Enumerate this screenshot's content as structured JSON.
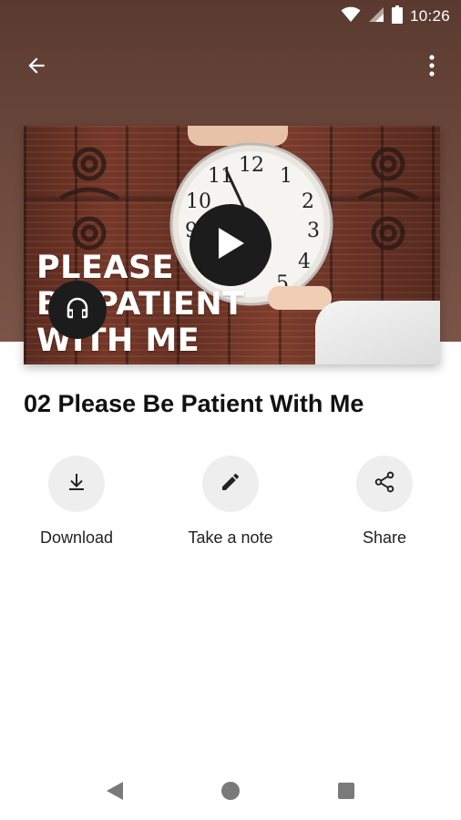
{
  "status_bar": {
    "time": "10:26",
    "icons": [
      "wifi-icon",
      "cell-signal-icon",
      "battery-icon"
    ]
  },
  "app_bar": {
    "back_icon": "arrow-left-icon",
    "menu_icon": "more-vertical-icon"
  },
  "thumbnail": {
    "title_text": "PLEASE\nBE PATIENT\nWITH ME",
    "clock_numbers": [
      "12",
      "1",
      "2",
      "3",
      "4",
      "5",
      "9",
      "10",
      "11"
    ],
    "play_icon": "play-icon",
    "audio_icon": "headphones-icon"
  },
  "episode": {
    "title": "02 Please Be Patient With Me"
  },
  "actions": [
    {
      "label": "Download",
      "icon": "download-icon"
    },
    {
      "label": "Take a note",
      "icon": "pencil-icon"
    },
    {
      "label": "Share",
      "icon": "share-icon"
    }
  ],
  "nav_bar": {
    "icons": [
      "back-triangle-icon",
      "home-circle-icon",
      "recents-square-icon"
    ]
  },
  "colors": {
    "header_brown": "#6e4a3e",
    "button_dark": "#1c1c1c",
    "action_circle": "#eeeeee"
  }
}
